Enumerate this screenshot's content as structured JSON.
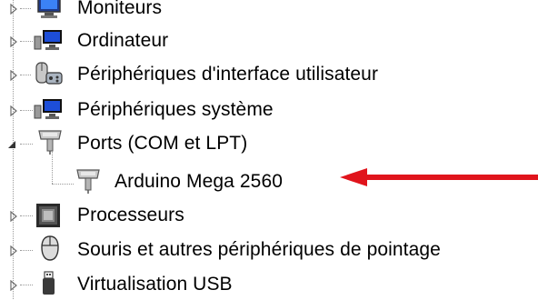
{
  "tree": {
    "items": [
      {
        "label": "Moniteurs",
        "icon": "monitor-icon",
        "expanded": false
      },
      {
        "label": "Ordinateur",
        "icon": "computer-icon",
        "expanded": false
      },
      {
        "label": "Périphériques d'interface utilisateur",
        "icon": "hid-icon",
        "expanded": false
      },
      {
        "label": "Périphériques système",
        "icon": "system-devices-icon",
        "expanded": false
      },
      {
        "label": "Ports (COM et LPT)",
        "icon": "port-icon",
        "expanded": true,
        "children": [
          {
            "label": "Arduino Mega 2560",
            "icon": "port-icon"
          }
        ]
      },
      {
        "label": "Processeurs",
        "icon": "processor-icon",
        "expanded": false
      },
      {
        "label": "Souris et autres périphériques de pointage",
        "icon": "mouse-icon",
        "expanded": false
      },
      {
        "label": "Virtualisation USB",
        "icon": "usb-icon",
        "expanded": false
      }
    ]
  },
  "annotation": {
    "arrow_color": "#e0141c"
  },
  "colors": {
    "tree_lines": "#9a9a9a",
    "expander": "#6d6d6d",
    "text": "#000000"
  }
}
